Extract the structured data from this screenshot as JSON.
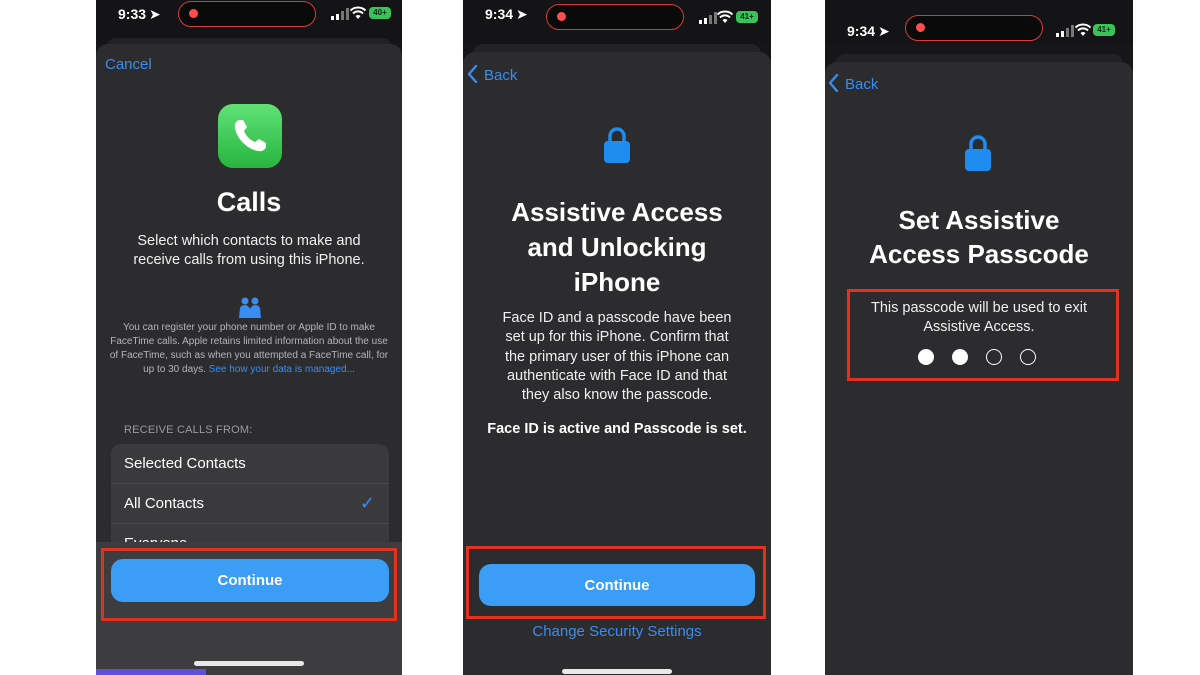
{
  "screens": [
    {
      "status": {
        "time": "9:33",
        "battery": "40+"
      },
      "nav": {
        "cancel_label": "Cancel"
      },
      "icon": "phone-app-icon",
      "title": "Calls",
      "description": "Select which contacts to make and receive calls from using this iPhone.",
      "privacy_icon": "people-handshake-icon",
      "privacy_text": "You can register your phone number or Apple ID to make FaceTime calls. Apple retains limited information about the use of FaceTime, such as when you attempted a FaceTime call, for up to 30 days.",
      "privacy_link": "See how your data is managed...",
      "section_header": "RECEIVE CALLS FROM:",
      "options": [
        {
          "label": "Selected Contacts",
          "selected": false
        },
        {
          "label": "All Contacts",
          "selected": true
        },
        {
          "label": "Everyone",
          "selected": false
        }
      ],
      "continue_label": "Continue"
    },
    {
      "status": {
        "time": "9:34",
        "battery": "41+"
      },
      "nav": {
        "back_label": "Back"
      },
      "icon": "lock-icon",
      "title": "Assistive Access and Unlocking iPhone",
      "description": "Face ID and a passcode have been set up for this iPhone. Confirm that the primary user of this iPhone can authenticate with Face ID and that they also know the passcode.",
      "status_line": "Face ID is active and Passcode is set.",
      "continue_label": "Continue",
      "secondary_link": "Change Security Settings"
    },
    {
      "status": {
        "time": "9:34",
        "battery": "41+"
      },
      "nav": {
        "back_label": "Back"
      },
      "icon": "lock-icon",
      "title": "Set Assistive Access Passcode",
      "description": "This passcode will be used to exit Assistive Access.",
      "passcode": {
        "entered": 2,
        "length": 4
      }
    }
  ],
  "colors": {
    "accent": "#3b8cf0",
    "button": "#3b9df5",
    "highlight": "#e3301f",
    "sheet": "#2c2c2e",
    "app_green": "#34c759"
  }
}
